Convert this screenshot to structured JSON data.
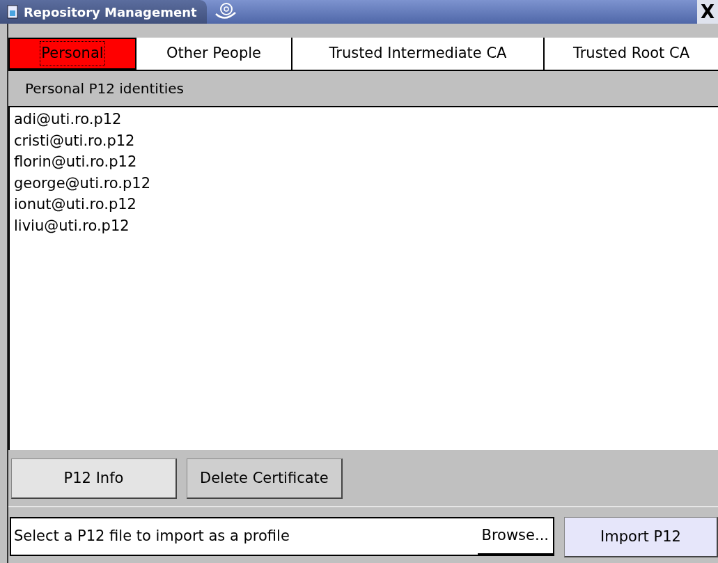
{
  "window": {
    "title": "Repository Management",
    "close": "X"
  },
  "tabs": [
    {
      "label": "Personal",
      "selected": true
    },
    {
      "label": "Other People",
      "selected": false
    },
    {
      "label": "Trusted Intermediate CA",
      "selected": false
    },
    {
      "label": "Trusted Root CA",
      "selected": false
    }
  ],
  "section_header": "Personal P12 identities",
  "identities": [
    "adi@uti.ro.p12",
    "cristi@uti.ro.p12",
    "florin@uti.ro.p12",
    "george@uti.ro.p12",
    "ionut@uti.ro.p12",
    "liviu@uti.ro.p12"
  ],
  "actions": [
    {
      "label": "P12 Info"
    },
    {
      "label": "Delete Certificate"
    }
  ],
  "import": {
    "placeholder": "Select a P12 file to import as a profile",
    "browse": "Browse...",
    "button": "Import P12"
  }
}
